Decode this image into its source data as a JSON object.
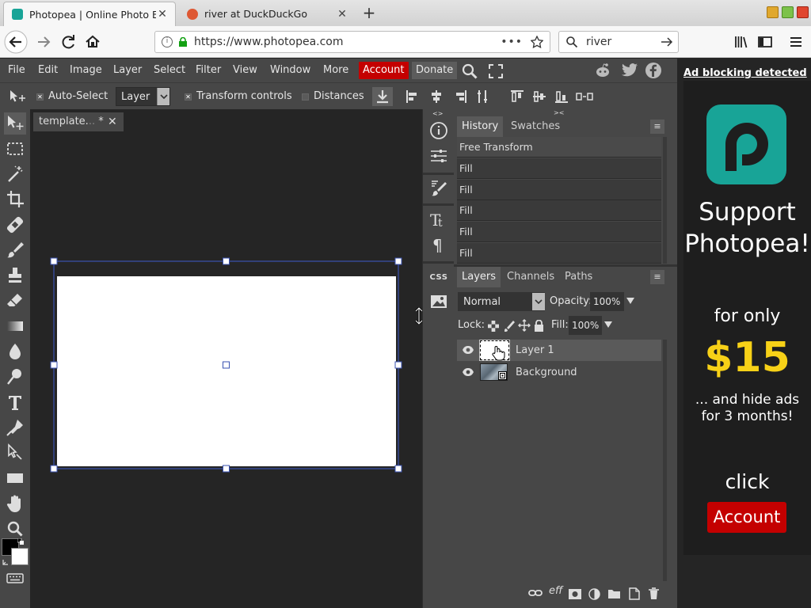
{
  "browser": {
    "tabs": [
      {
        "title": "Photopea | Online Photo Edit",
        "active": true
      },
      {
        "title": "river at DuckDuckGo",
        "active": false
      }
    ],
    "url": "https://www.photopea.com",
    "search_value": "river"
  },
  "menu": [
    "File",
    "Edit",
    "Image",
    "Layer",
    "Select",
    "Filter",
    "View",
    "Window",
    "More"
  ],
  "account_label": "Account",
  "donate_label": "Donate",
  "options": {
    "auto_select": "Auto-Select",
    "layer_select": "Layer",
    "transform_controls": "Transform controls",
    "distances": "Distances"
  },
  "document_tab": "template.",
  "document_tab_suffix": "*",
  "history": {
    "tabs": [
      "History",
      "Swatches"
    ],
    "items": [
      "Free Transform",
      "Fill",
      "Fill",
      "Fill",
      "Fill",
      "Fill"
    ]
  },
  "layers_panel": {
    "tabs": [
      "Layers",
      "Channels",
      "Paths"
    ],
    "blend_mode": "Normal",
    "opacity_label": "Opacity:",
    "opacity": "100%",
    "lock_label": "Lock:",
    "fill_label": "Fill:",
    "fill": "100%",
    "layers": [
      "Layer 1",
      "Background"
    ]
  },
  "mid_icons": [
    "css-icon"
  ],
  "mid_css_label": "CSS",
  "ad": {
    "top_link": "Ad blocking detected",
    "headline_1": "Support",
    "headline_2": "Photopea!",
    "for_only": "for only",
    "price": "$15",
    "sub_1": "... and hide ads",
    "sub_2": "for 3 months!",
    "click": "click",
    "button": "Account"
  },
  "colors": {
    "accent_red": "#c40000",
    "ad_teal": "#18a497",
    "price_yellow": "#f7d117",
    "panel": "#474747",
    "workspace": "#252525"
  }
}
